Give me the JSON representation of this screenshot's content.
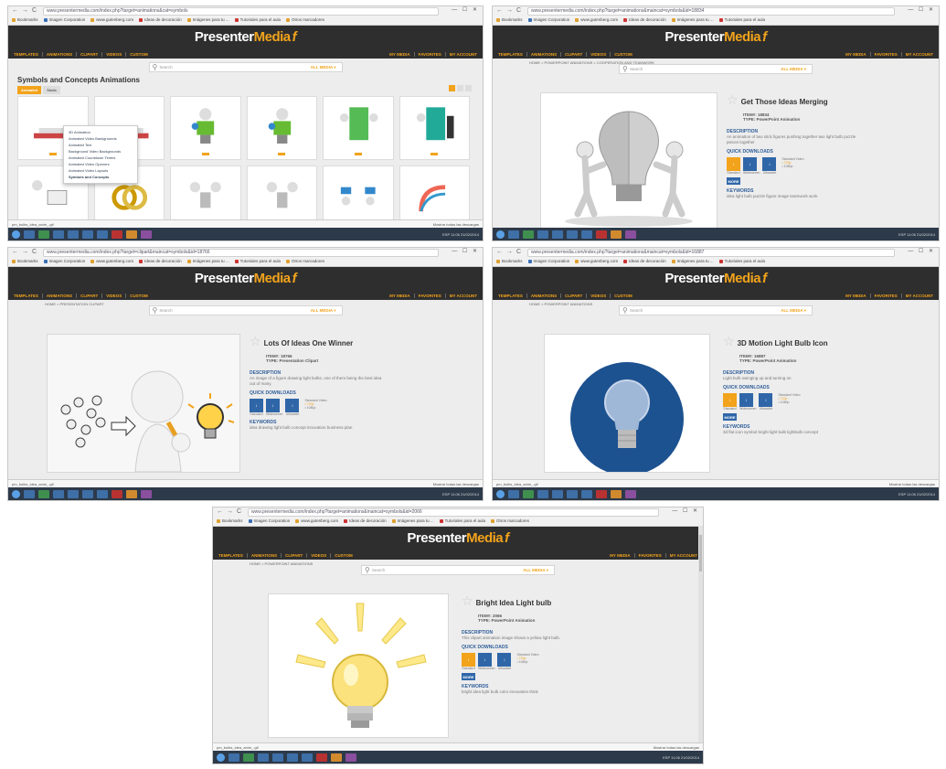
{
  "browser": {
    "nav_buttons": [
      "←",
      "→",
      "C"
    ],
    "bookmarks": [
      "Bookmarks",
      "Imagen Corporation",
      "www.gutenberg.com",
      "Ideas de decoración",
      "Imágenes para tu ...",
      "Tutoriales para el aula",
      "Otros marcadores"
    ],
    "window_controls": "— ☐ ✕",
    "urls": [
      "www.presentermedia.com/index.php?target=animations&cat=symbols",
      "www.presentermedia.com/index.php?target=animations&maincat=symbols&id=18834",
      "www.presentermedia.com/index.php?target=clipart&maincat=symbols&id=18766",
      "www.presentermedia.com/index.php?target=animations&maincat=symbols&id=16887",
      "www.presentermedia.com/index.php?target=animations&maincat=symbols&id=2066"
    ],
    "status_left": "pm_bulbs_idea_anim_.gif",
    "status_right": "Mostrar todas las descargas"
  },
  "site": {
    "logo_presenter": "Presenter",
    "logo_media": "Media",
    "logo_f": "f",
    "nav_left": [
      "Templates",
      "Animations",
      "Clipart",
      "Videos",
      "Custom"
    ],
    "nav_right": [
      "My Media",
      "Favorites",
      "My Account"
    ],
    "search_icon": "magnifier-icon",
    "search_placeholder": "Search",
    "search_scope": "ALL MEDIA ▾"
  },
  "shot1": {
    "page_title": "Symbols and Concepts Animations",
    "filters": [
      "Animated",
      "Static"
    ],
    "dropdown": [
      "3D Animation",
      "Animated Video Backgrounds",
      "Animated Text",
      "Background Video Backgrounds",
      "Animated Countdown Timers",
      "Animated Video Openers",
      "Animated Video Layouts",
      "Symbols and Concepts"
    ]
  },
  "products": [
    {
      "breadcrumb": "Home > PowerPoint Animations > Cooperation and Teamwork",
      "title": "Get Those Ideas Merging",
      "item": "ITEM#: 18834",
      "type": "TYPE: PowerPoint Animation",
      "desc": "An animation of two stick figures pushing together two light bulb puzzle pieces together",
      "keywords": "idea light bulb puzzle figure image teamwork work"
    },
    {
      "breadcrumb": "Home > Presentation Clipart",
      "title": "Lots Of Ideas One Winner",
      "item": "ITEM#: 18766",
      "type": "TYPE: Presentation Clipart",
      "desc": "An image of a figure drawing light bulbs, one of them being the best idea out of many.",
      "keywords": "idea drawing light bulb concept innovation business plan"
    },
    {
      "breadcrumb": "Home > PowerPoint Animations",
      "title": "3D Motion Light Bulb Icon",
      "item": "ITEM#: 16887",
      "type": "TYPE: PowerPoint Animation",
      "desc": "Light bulb swinging up and turning on",
      "keywords": "3d flat icon symbol bright light bulb lightbulb concept"
    },
    {
      "breadcrumb": "Home > PowerPoint Animations",
      "title": "Bright Idea Light bulb",
      "item": "ITEM#: 2066",
      "type": "TYPE: PowerPoint Animation",
      "desc": "This clipart animation image shows a yellow light bulb.",
      "keywords": "bright idea light bulb color innovation think"
    }
  ],
  "labels": {
    "description": "Description",
    "quick_downloads": "Quick Downloads",
    "keywords": "Keywords",
    "more": "MORE",
    "dl_caps": [
      "Standard",
      "Widescreen",
      "Ultrawide"
    ],
    "dl_glyphs": [
      "↓",
      "↓",
      "↓"
    ],
    "opts": [
      "Standard Video",
      "• 720p",
      "• 1080p"
    ],
    "fav_star": "☆"
  },
  "taskbar": {
    "tray": "ESP 11:06 21/02/2014"
  },
  "colors": {
    "accent": "#f2a31b",
    "header": "#2e2e2e",
    "link_blue": "#2f5d99"
  }
}
